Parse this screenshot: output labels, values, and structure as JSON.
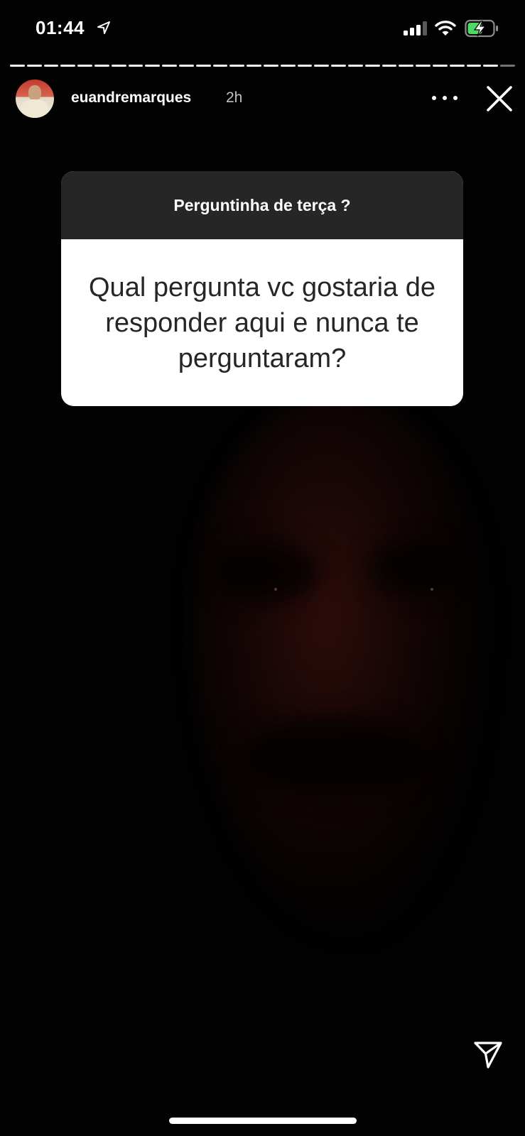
{
  "status_bar": {
    "time": "01:44",
    "icons": [
      "location-arrow-icon",
      "cellular-signal-icon",
      "wifi-icon",
      "battery-charging-icon"
    ],
    "battery_color": "#4cd964"
  },
  "story": {
    "segments_total": 30,
    "segments_viewed": 29,
    "username": "euandremarques",
    "time_ago": "2h",
    "icons": {
      "more": "more-dots-icon",
      "close": "close-icon",
      "share": "send-icon"
    }
  },
  "question_sticker": {
    "prompt": "Perguntinha de terça ?",
    "question": "Qual pergunta vc gostaria de responder aqui e nunca te perguntaram?",
    "header_color": "#262626",
    "body_color": "#ffffff"
  }
}
